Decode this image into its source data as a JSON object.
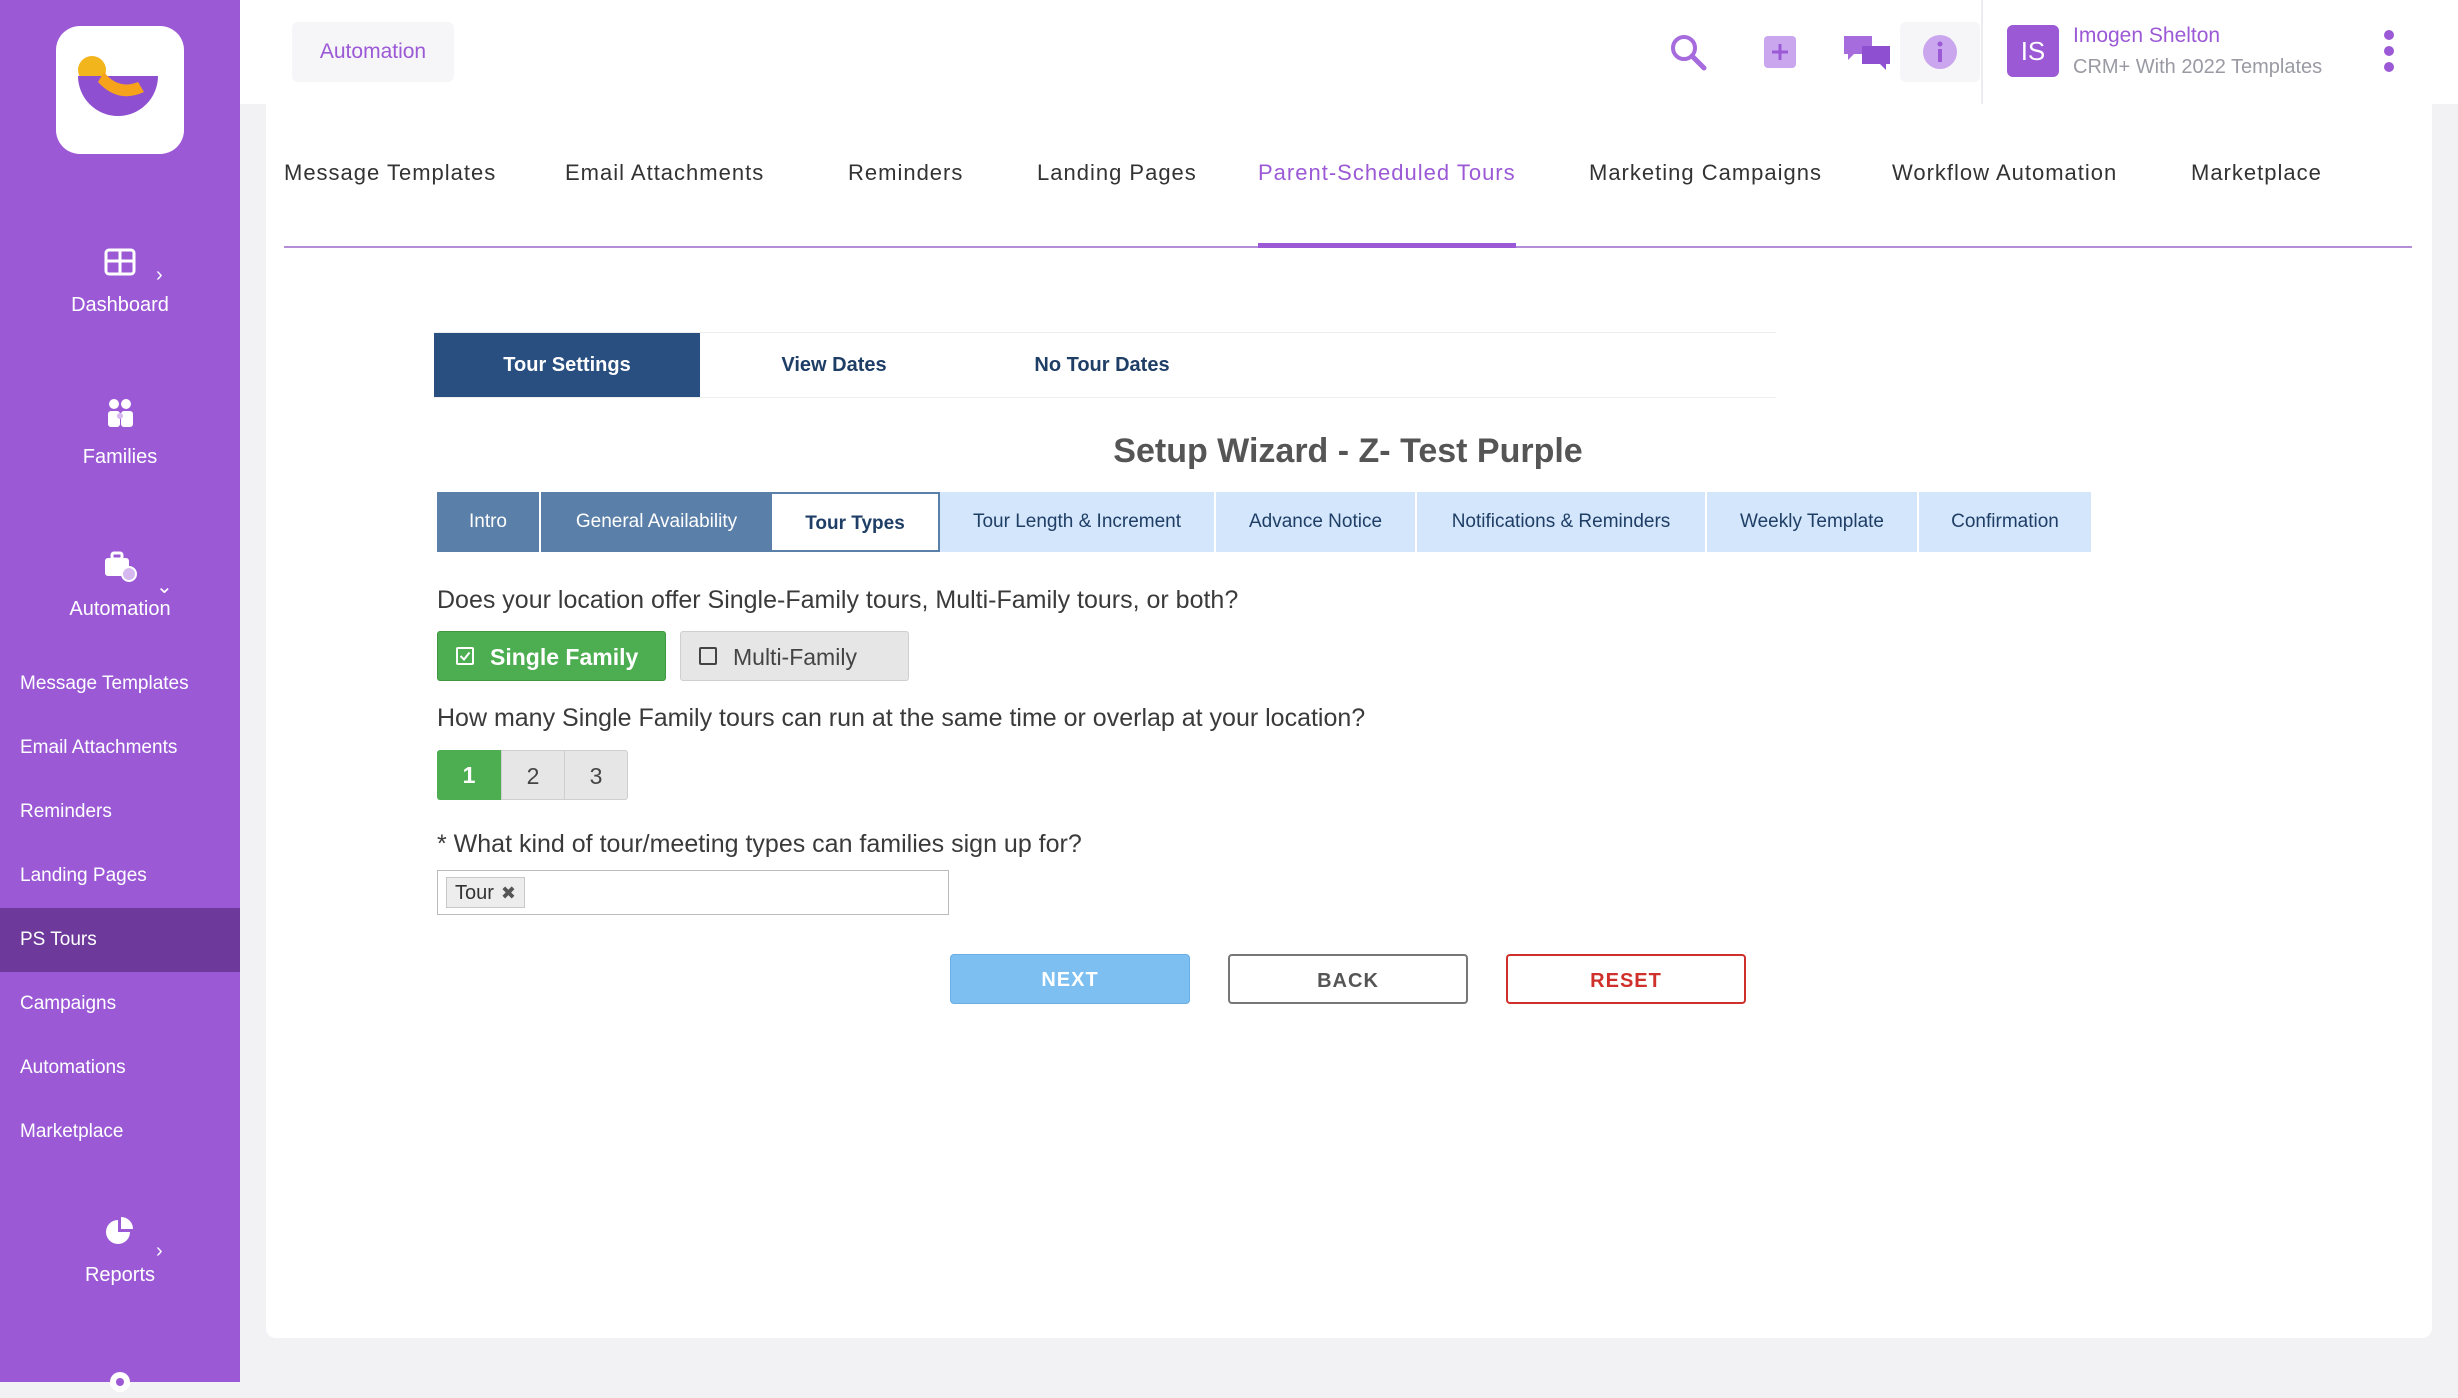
{
  "sidebar": {
    "groups": {
      "dashboard": "Dashboard",
      "families": "Families",
      "automation": "Automation",
      "reports": "Reports"
    },
    "items": [
      {
        "label": "Message Templates"
      },
      {
        "label": "Email Attachments"
      },
      {
        "label": "Reminders"
      },
      {
        "label": "Landing Pages"
      },
      {
        "label": "PS Tours",
        "active": true
      },
      {
        "label": "Campaigns"
      },
      {
        "label": "Automations"
      },
      {
        "label": "Marketplace"
      }
    ]
  },
  "header": {
    "breadcrumb": "Automation",
    "user": {
      "initials": "IS",
      "name": "Imogen Shelton",
      "subtitle": "CRM+ With 2022 Templates"
    },
    "icons": [
      "search-icon",
      "add-icon",
      "chat-icon",
      "info-icon",
      "more-vertical-icon"
    ]
  },
  "top_tabs": [
    {
      "label": "Message Templates"
    },
    {
      "label": "Email Attachments"
    },
    {
      "label": "Reminders"
    },
    {
      "label": "Landing Pages"
    },
    {
      "label": "Parent-Scheduled Tours",
      "active": true
    },
    {
      "label": "Marketing Campaigns"
    },
    {
      "label": "Workflow Automation"
    },
    {
      "label": "Marketplace"
    }
  ],
  "sub_tabs": [
    {
      "label": "Tour Settings",
      "active": true
    },
    {
      "label": "View Dates"
    },
    {
      "label": "No Tour Dates"
    }
  ],
  "wizard": {
    "title": "Setup Wizard - Z- Test Purple",
    "steps": [
      {
        "label": "Intro",
        "state": "done"
      },
      {
        "label": "General Availability",
        "state": "done"
      },
      {
        "label": "Tour Types",
        "state": "current"
      },
      {
        "label": "Tour Length & Increment",
        "state": "todo"
      },
      {
        "label": "Advance Notice",
        "state": "todo"
      },
      {
        "label": "Notifications & Reminders",
        "state": "todo"
      },
      {
        "label": "Weekly Template",
        "state": "todo"
      },
      {
        "label": "Confirmation",
        "state": "todo"
      }
    ],
    "q1": "Does your location offer Single-Family tours, Multi-Family tours, or both?",
    "q1_options": [
      {
        "label": "Single Family",
        "checked": true
      },
      {
        "label": "Multi-Family",
        "checked": false
      }
    ],
    "q2": "How many Single Family tours can run at the same time or overlap at your location?",
    "q2_options": [
      "1",
      "2",
      "3"
    ],
    "q2_selected": "1",
    "q3": "* What kind of tour/meeting types can families sign up for?",
    "q3_tags": [
      "Tour"
    ],
    "buttons": {
      "next": "NEXT",
      "back": "BACK",
      "reset": "RESET"
    }
  },
  "colors": {
    "brand": "#9b59d6",
    "sidebar_active": "#6d3a9c",
    "subtab_active": "#284f80",
    "step_done": "#5a7fa8",
    "step_todo": "#d3e6fb",
    "selected_green": "#4cae50",
    "next_button": "#7dbff0",
    "reset_red": "#d0302b"
  }
}
